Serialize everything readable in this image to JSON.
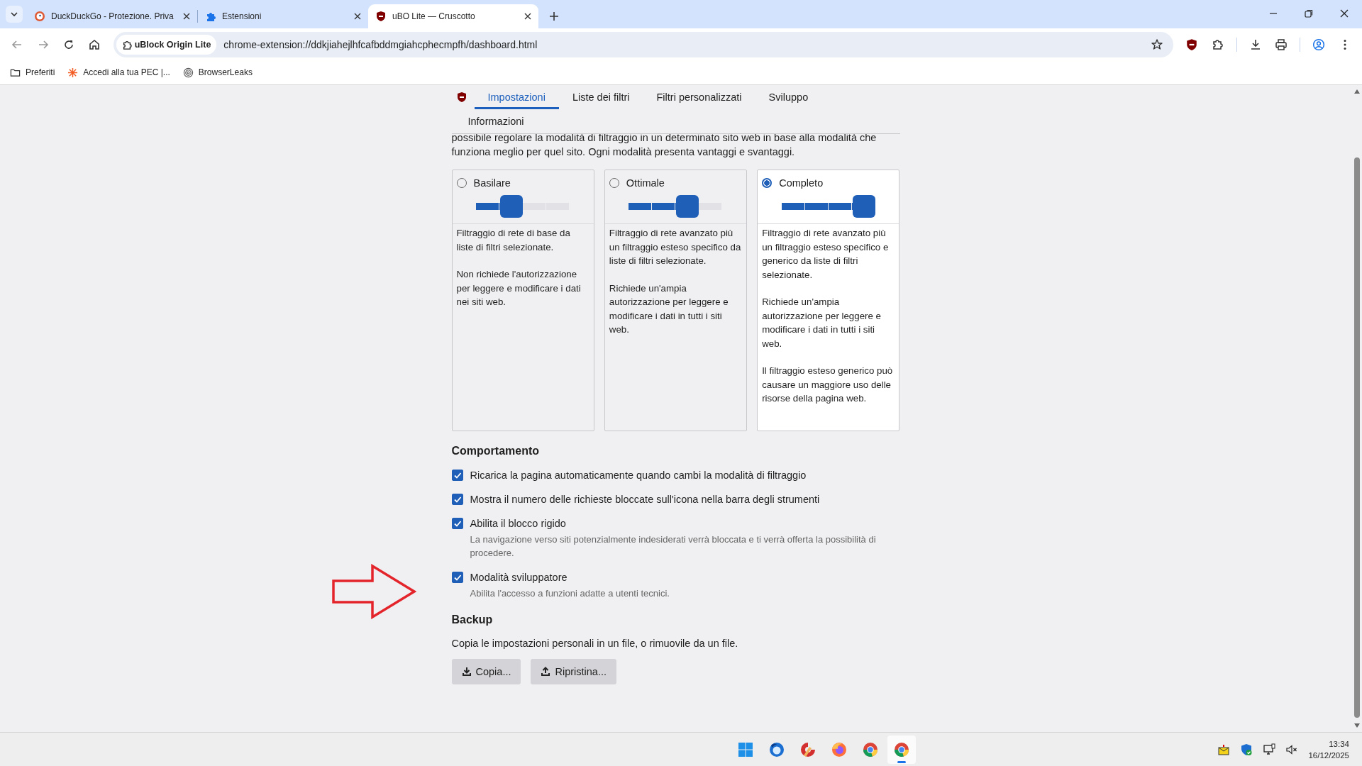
{
  "browser": {
    "tabs": [
      {
        "title": "DuckDuckGo - Protezione. Priva",
        "kind": "duck",
        "selected": false
      },
      {
        "title": "Estensioni",
        "kind": "puzzle",
        "selected": false
      },
      {
        "title": "uBO Lite — Cruscotto",
        "kind": "shield",
        "selected": true
      }
    ],
    "address": {
      "badge": "uBlock Origin Lite",
      "url": "chrome-extension://ddkjiahejlhfcafbddmgiahcphecmpfh/dashboard.html"
    },
    "bookmarks": [
      {
        "label": "Preferiti",
        "kind": "folder"
      },
      {
        "label": "Accedi alla tua PEC |...",
        "kind": "spark"
      },
      {
        "label": "BrowserLeaks",
        "kind": "fingerprint"
      }
    ]
  },
  "dashboard": {
    "nav": [
      {
        "label": "Impostazioni",
        "selected": true
      },
      {
        "label": "Liste dei filtri",
        "selected": false
      },
      {
        "label": "Filtri personalizzati",
        "selected": false
      },
      {
        "label": "Sviluppo",
        "selected": false
      },
      {
        "label": "Informazioni",
        "selected": false
      }
    ],
    "intro": [
      "possibile regolare la modalità di filtraggio in un determinato sito web in base alla modalità che",
      "funziona meglio per quel sito. Ogni modalità presenta vantaggi e svantaggi."
    ],
    "modes": [
      {
        "label": "Basilare",
        "selected": false,
        "level": 0.5,
        "paragraphs": [
          "Filtraggio di rete di base da liste di filtri selezionate.",
          "Non richiede l'autorizzazione per leggere e modificare i dati nei siti web."
        ]
      },
      {
        "label": "Ottimale",
        "selected": false,
        "level": 0.75,
        "paragraphs": [
          "Filtraggio di rete avanzato più un filtraggio esteso specifico da liste di filtri selezionate.",
          "Richiede un'ampia autorizzazione per leggere e modificare i dati in tutti i siti web."
        ]
      },
      {
        "label": "Completo",
        "selected": true,
        "level": 1,
        "paragraphs": [
          "Filtraggio di rete avanzato più un filtraggio esteso specifico e generico da liste di filtri selezionate.",
          "Richiede un'ampia autorizzazione per leggere e modificare i dati in tutti i siti web.",
          "Il filtraggio esteso generico può causare un maggiore uso delle risorse della pagina web."
        ]
      }
    ],
    "behavior": {
      "heading": "Comportamento",
      "options": [
        {
          "label": "Ricarica la pagina automaticamente quando cambi la modalità di filtraggio",
          "checked": true
        },
        {
          "label": "Mostra il numero delle richieste bloccate sull'icona nella barra degli strumenti",
          "checked": true
        },
        {
          "label": "Abilita il blocco rigido",
          "checked": true,
          "description": "La navigazione verso siti potenzialmente indesiderati verrà bloccata e ti verrà offerta la possibilità di procedere."
        },
        {
          "label": "Modalità sviluppatore",
          "checked": true,
          "description": "Abilita l'accesso a funzioni adatte a utenti tecnici."
        }
      ]
    },
    "backup": {
      "heading": "Backup",
      "text": "Copia le impostazioni personali in un file, o rimuovile da un file.",
      "buttons": [
        {
          "label": "Copia...",
          "kind": "download"
        },
        {
          "label": "Ripristina...",
          "kind": "upload"
        }
      ]
    }
  },
  "taskbar": {
    "apps": [
      {
        "kind": "windows",
        "selected": false
      },
      {
        "kind": "mail",
        "selected": false
      },
      {
        "kind": "cleaner",
        "selected": false
      },
      {
        "kind": "firefox",
        "selected": false
      },
      {
        "kind": "chrome",
        "selected": false
      },
      {
        "kind": "chrome",
        "selected": true
      }
    ],
    "time": "13:34",
    "date": "16/12/2025"
  }
}
